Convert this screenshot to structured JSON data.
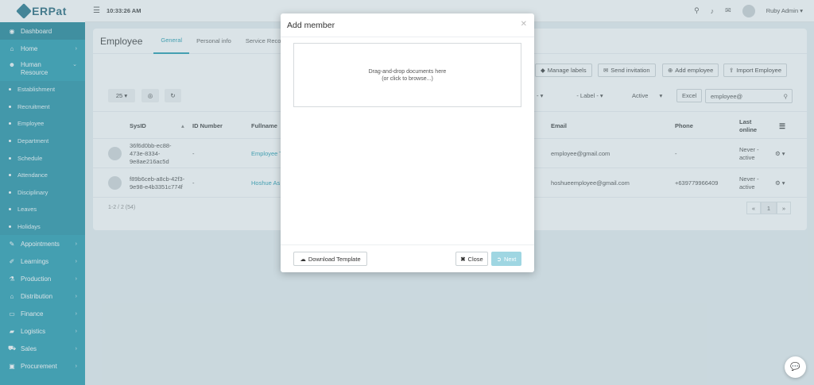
{
  "brand": {
    "name": "ERPat"
  },
  "topbar": {
    "time": "10:33:26 AM",
    "user": "Ruby Admin ▾"
  },
  "sidebar": {
    "items": [
      {
        "label": "Dashboard",
        "icon": "dashboard-icon",
        "glyph": "◉"
      },
      {
        "label": "Home",
        "icon": "home-icon",
        "glyph": "⌂"
      },
      {
        "label": "Human Resource",
        "icon": "users-icon",
        "glyph": "☻"
      }
    ],
    "sub": [
      "Establishment",
      "Recruitment",
      "Employee",
      "Department",
      "Schedule",
      "Attendance",
      "Disciplinary",
      "Leaves",
      "Holidays"
    ],
    "items2": [
      {
        "label": "Appointments",
        "icon": "edit-icon",
        "glyph": "✎"
      },
      {
        "label": "Learnings",
        "icon": "pencil-icon",
        "glyph": "✐"
      },
      {
        "label": "Production",
        "icon": "flask-icon",
        "glyph": "⚗"
      },
      {
        "label": "Distribution",
        "icon": "bank-icon",
        "glyph": "⌂"
      },
      {
        "label": "Finance",
        "icon": "money-icon",
        "glyph": "▭"
      },
      {
        "label": "Logistics",
        "icon": "truck-icon",
        "glyph": "▰"
      },
      {
        "label": "Sales",
        "icon": "cart-icon",
        "glyph": "⛟"
      },
      {
        "label": "Procurement",
        "icon": "box-icon",
        "glyph": "▣"
      }
    ]
  },
  "page": {
    "title": "Employee",
    "tabs": [
      "General",
      "Personal info",
      "Service Record"
    ],
    "buttons": {
      "manage_labels": "Manage labels",
      "send_invitation": "Send invitation",
      "add_employee": "Add employee",
      "import_employee": "Import Employee"
    },
    "page_size": "25",
    "filters": {
      "f1": "- ▾",
      "label": "- Label -",
      "status": "Active",
      "excel": "Excel"
    },
    "search_value": "employee@",
    "columns": [
      "SysID",
      "ID Number",
      "Fullname",
      "Email",
      "Phone",
      "Last online"
    ],
    "rows": [
      {
        "sysid": "36f6d0bb-ec88-473e-8334-9e8ae216ac5d",
        "idnum": "-",
        "name": "Employee T",
        "email": "employee@gmail.com",
        "phone": "-",
        "last": "Never - active"
      },
      {
        "sysid": "f89b6ceb-a8cb-42f3-9e98-e4b3351c774f",
        "idnum": "-",
        "name": "Hoshue As",
        "email": "hoshueemployee@gmail.com",
        "phone": "+639779966409",
        "last": "Never - active"
      }
    ],
    "count": "1-2 / 2 (54)",
    "pager": {
      "prev": "«",
      "current": "1",
      "next": "»"
    }
  },
  "modal": {
    "title": "Add member",
    "drop_line1": "Drag-and-drop documents here",
    "drop_line2": "(or click to browse...)",
    "download": "Download Template",
    "close": "Close",
    "next": "Next"
  }
}
